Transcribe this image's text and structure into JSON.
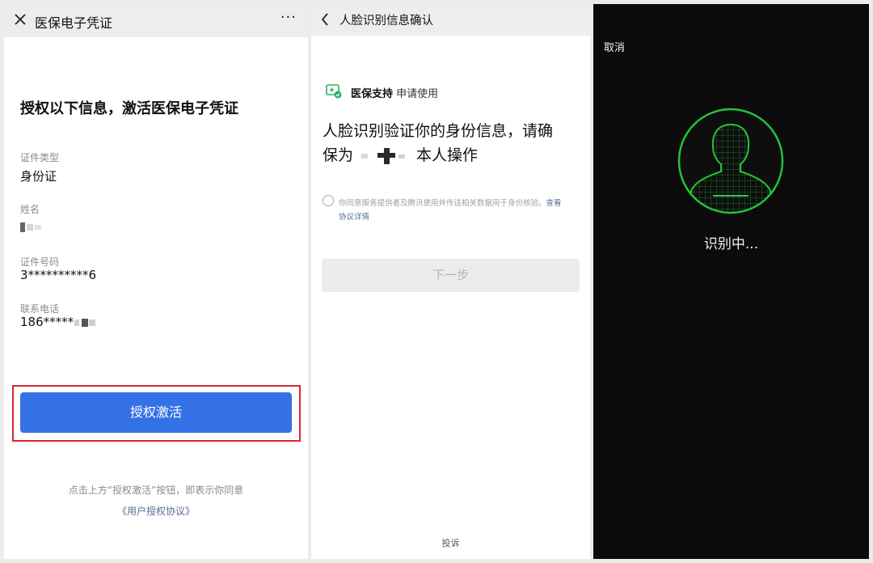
{
  "panel1": {
    "title": "医保电子凭证",
    "more": "···",
    "heading": "授权以下信息，激活医保电子凭证",
    "fields": [
      {
        "label": "证件类型",
        "value": "身份证"
      },
      {
        "label": "姓名",
        "value": ""
      },
      {
        "label": "证件号码",
        "value": "3**********6"
      },
      {
        "label": "联系电话",
        "value": "186*****"
      }
    ],
    "activate_label": "授权激活",
    "notice": "点击上方“授权激活”按钮，即表示你同意",
    "agreement_link": "《用户授权协议》",
    "highlight_color": "#d9272e",
    "button_color": "#3571e6"
  },
  "panel2": {
    "title": "人脸识别信息确认",
    "app_name": "医保支持",
    "app_request": "申请使用",
    "main_line1": "人脸识别验证你的身份信息，请确",
    "main_line2_pre": "保为",
    "main_line2_post": "本人操作",
    "agree_text": "你同意服务提供者及腾讯使用并传送相关数据用于身份核验。",
    "agree_link1": "查看",
    "agree_link2": "协议详情",
    "next_label": "下一步",
    "complain": "投诉"
  },
  "panel3": {
    "cancel": "取消",
    "status": "识别中...",
    "accent_color": "#23c43a"
  }
}
